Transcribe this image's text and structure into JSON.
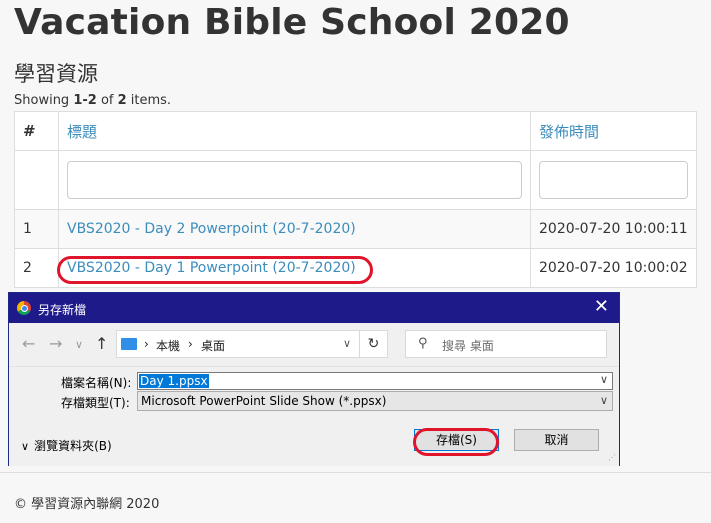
{
  "page": {
    "title": "Vacation Bible School 2020",
    "section_title": "學習資源",
    "summary": {
      "prefix": "Showing ",
      "range": "1-2",
      "middle": " of ",
      "total": "2",
      "suffix": " items."
    }
  },
  "table": {
    "headers": {
      "num": "#",
      "title": "標題",
      "published": "發佈時間"
    },
    "rows": [
      {
        "num": "1",
        "title": "VBS2020 - Day 2 Powerpoint (20-7-2020)",
        "published": "2020-07-20 10:00:11"
      },
      {
        "num": "2",
        "title": "VBS2020 - Day 1 Powerpoint (20-7-2020)",
        "published": "2020-07-20 10:00:02"
      }
    ]
  },
  "footer": {
    "text": "© 學習資源內聯網 2020"
  },
  "dialog": {
    "title": "另存新檔",
    "close": "✕",
    "nav": {
      "back": "←",
      "forward": "→",
      "dropdown": "∨",
      "up": "↑"
    },
    "breadcrumb": {
      "sep1": "›",
      "this_pc": "本機",
      "sep2": "›",
      "desktop": "桌面"
    },
    "refresh": "↻",
    "search_placeholder": "搜尋 桌面",
    "filename_label": "檔案名稱(N):",
    "filename_value": "Day 1.ppsx",
    "filetype_label": "存檔類型(T):",
    "filetype_value": "Microsoft PowerPoint Slide Show (*.ppsx)",
    "browse_folders": "瀏覽資料夾(B)",
    "save": "存檔(S)",
    "cancel": "取消",
    "annotation_color": "#e0142a",
    "titlebar_color": "#1e1a8a"
  }
}
